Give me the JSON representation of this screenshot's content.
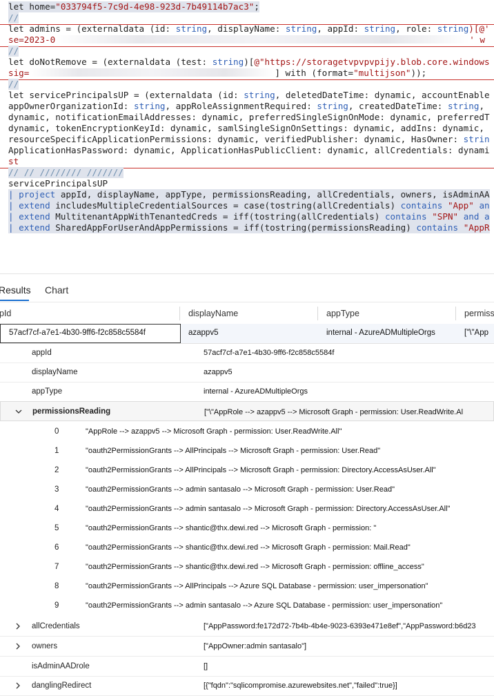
{
  "editor": {
    "line1": {
      "a": "let home=",
      "b": "\"033794f5-7c9d-4e98-923d-7b49114b7ac3\"",
      "c": ";"
    },
    "line2": "//",
    "line3": {
      "a": "let admins = (externaldata (id: ",
      "b": "string",
      "c": ", displayName: ",
      "d": "string",
      "e": ", appId: ",
      "f": "string",
      "g": ", role: ",
      "h": "string",
      "i": ")[@'"
    },
    "line4": {
      "a": "se=2023-0",
      "b": "' w"
    },
    "line5": "//",
    "line6": {
      "a": "let doNotRemove = (externaldata (test: ",
      "b": "string",
      "c": ")[",
      "d": "@\"https://storagetvpvpvpijy.blob.core.windows"
    },
    "line7": {
      "a": "sig=",
      "b": "] with (format=",
      "c": "\"multijson\"",
      "d": "));"
    },
    "line8": "//",
    "line9": {
      "a": "let servicePrincipalsUP = (externaldata (id: ",
      "b": "string",
      "c": ", deletedDateTime: dynamic, accountEnable"
    },
    "line10": {
      "a": "appOwnerOrganizationId: ",
      "b": "string",
      "c": ", appRoleAssignmentRequired: ",
      "d": "string",
      "e": ", createdDateTime: ",
      "f": "string",
      "g": ","
    },
    "line11": "dynamic, notificationEmailAddresses: dynamic, preferredSingleSignOnMode: dynamic, preferredT",
    "line12": {
      "a": "dynamic, tokenEncryptionKeyId: dynamic, samlSingleSignOnSettings: dynamic, addIns: dynamic, ",
      "b": ""
    },
    "line13": {
      "a": "resourceSpecificApplicationPermissions: dynamic, verifiedPublisher: dynamic, HasOwner: ",
      "b": "strin"
    },
    "line14": "ApplicationHasPassword: dynamic, ApplicationHasPublicClient: dynamic, allCredentials: dynami",
    "line15": "st",
    "line16": "// // //////// ///////",
    "line17": "servicePrincipalsUP",
    "line18": {
      "a": "| ",
      "b": "project",
      "c": " appId, displayName, appType, permissionsReading, allCredentials, owners, isAdminAA"
    },
    "line19": {
      "a": "| ",
      "b": "extend",
      "c": " includesMultipleCredentialSources = case(tostring(allCredentials) ",
      "d": "contains",
      "e": " ",
      "f": "\"App\"",
      "g": " an"
    },
    "line20": {
      "a": "| ",
      "b": "extend",
      "c": " MultitenantAppWithTenantedCreds = iff(tostring(allCredentials) ",
      "d": "contains",
      "e": " ",
      "f": "\"SPN\"",
      "g": " and a"
    },
    "line21": {
      "a": "| ",
      "b": "extend",
      "c": " SharedAppForUserAndAppPermissions = iff(tostring(permissionsReading) ",
      "d": "contains",
      "e": " ",
      "f": "\"AppR"
    }
  },
  "tabs": {
    "results": "Results",
    "chart": "Chart"
  },
  "columns": {
    "c1": "pId",
    "c2": "displayName",
    "c3": "appType",
    "c4": "permiss"
  },
  "selected_row": {
    "appId": "57acf7cf-a7e1-4b30-9ff6-f2c858c5584f",
    "displayName": "azappv5",
    "appType": "internal - AzureADMultipleOrgs",
    "permiss": "[\"\\\"App"
  },
  "details": {
    "appId": {
      "name": "appId",
      "value": "57acf7cf-a7e1-4b30-9ff6-f2c858c5584f"
    },
    "displayName": {
      "name": "displayName",
      "value": "azappv5"
    },
    "appType": {
      "name": "appType",
      "value": "internal - AzureADMultipleOrgs"
    },
    "permissionsReading": {
      "name": "permissionsReading",
      "value": "[\"\\\"AppRole --> azappv5 --> Microsoft Graph - permission: User.ReadWrite.Al"
    },
    "permissions": [
      {
        "index": "0",
        "text": "\"AppRole --> azappv5 --> Microsoft Graph - permission: User.ReadWrite.All\""
      },
      {
        "index": "1",
        "text": "\"oauth2PermissionGrants --> AllPrincipals --> Microsoft Graph - permission: User.Read\""
      },
      {
        "index": "2",
        "text": "\"oauth2PermissionGrants --> AllPrincipals --> Microsoft Graph - permission: Directory.AccessAsUser.All\""
      },
      {
        "index": "3",
        "text": "\"oauth2PermissionGrants --> admin santasalo --> Microsoft Graph - permission: User.Read\""
      },
      {
        "index": "4",
        "text": "\"oauth2PermissionGrants --> admin santasalo --> Microsoft Graph - permission: Directory.AccessAsUser.All\""
      },
      {
        "index": "5",
        "text": "\"oauth2PermissionGrants --> shantic@thx.dewi.red --> Microsoft Graph - permission: \""
      },
      {
        "index": "6",
        "text": "\"oauth2PermissionGrants --> shantic@thx.dewi.red --> Microsoft Graph - permission: Mail.Read\""
      },
      {
        "index": "7",
        "text": "\"oauth2PermissionGrants --> shantic@thx.dewi.red --> Microsoft Graph - permission: offline_access\""
      },
      {
        "index": "8",
        "text": "\"oauth2PermissionGrants --> AllPrincipals --> Azure SQL Database - permission: user_impersonation\""
      },
      {
        "index": "9",
        "text": "\"oauth2PermissionGrants --> admin santasalo --> Azure SQL Database - permission: user_impersonation\""
      }
    ],
    "allCredentials": {
      "name": "allCredentials",
      "value": "[\"AppPassword:fe172d72-7b4b-4b4e-9023-6393e471e8ef\",\"AppPassword:b6d23"
    },
    "owners": {
      "name": "owners",
      "value": "[\"AppOwner:admin santasalo\"]"
    },
    "isAdminAADrole": {
      "name": "isAdminAADrole",
      "value": "[]"
    },
    "danglingRedirect": {
      "name": "danglingRedirect",
      "value": "[{\"fqdn\":\"sqlicompromise.azurewebsites.net\",\"failed\":true}]"
    }
  }
}
